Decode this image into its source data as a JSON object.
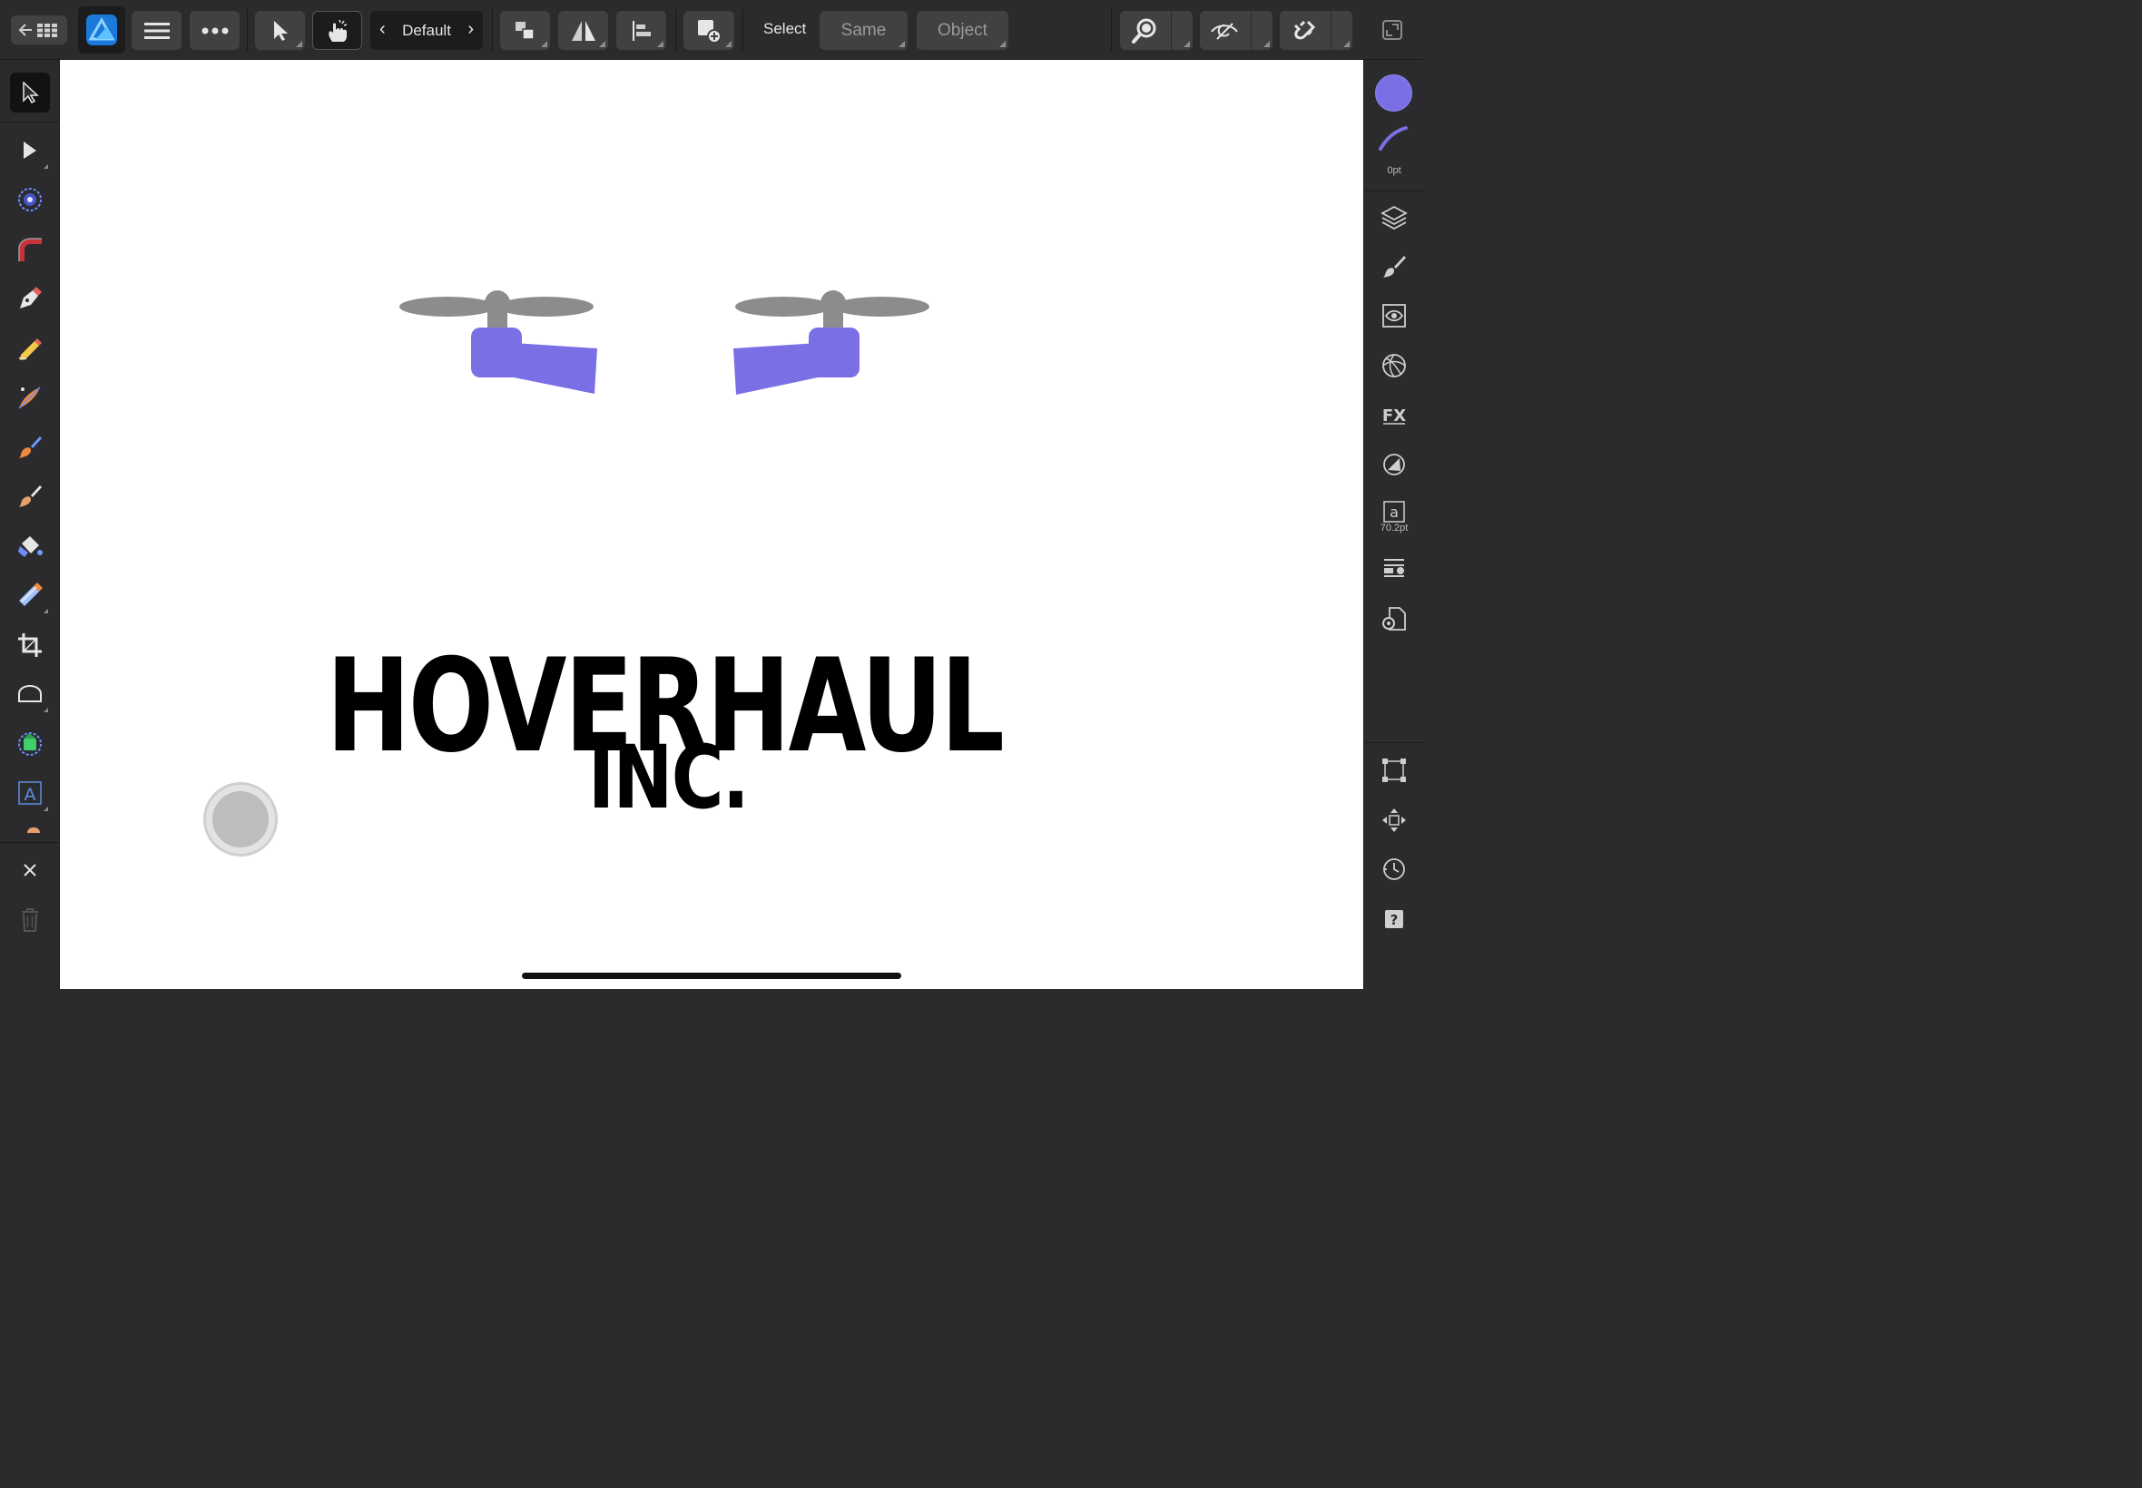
{
  "toolbar": {
    "back_icon": "back-to-gallery-icon",
    "app_icon": "affinity-designer-icon",
    "menu_icon": "hamburger-menu-icon",
    "more_icon": "more-dots-icon",
    "move_icon": "move-tool-icon",
    "gesture_icon": "gesture-touch-icon",
    "preset": {
      "label": "Default"
    },
    "arrange_icon": "arrange-icon",
    "flip_icon": "flip-icon",
    "align_icon": "align-icon",
    "insert_icon": "insert-icon",
    "select_label": "Select",
    "same_label": "Same",
    "object_label": "Object",
    "zoom_icon": "zoom-icon",
    "view_icon": "view-mode-icon",
    "snapping_icon": "snapping-magnet-icon",
    "fullscreen_icon": "fullscreen-icon"
  },
  "left_tools": [
    "move-tool",
    "node-tool",
    "corner-tool",
    "point-transform-tool",
    "pen-tool",
    "pencil-tool",
    "vector-brush-tool",
    "paint-brush-tool",
    "pixel-brush-tool",
    "fill-tool",
    "transparency-tool",
    "crop-tool",
    "shape-tool",
    "place-image-tool",
    "artistic-text-tool"
  ],
  "right_panel": {
    "fill_color": "#7b6fe6",
    "stroke_color": "#7b6fe6",
    "stroke_width_label": "0pt",
    "text_size_label": "70.2pt"
  },
  "canvas": {
    "logo": {
      "title": "HOVERHAUL",
      "subtitle": "INC.",
      "purple": "#7b6fe6",
      "propeller_gray": "#8c8c8c"
    }
  }
}
